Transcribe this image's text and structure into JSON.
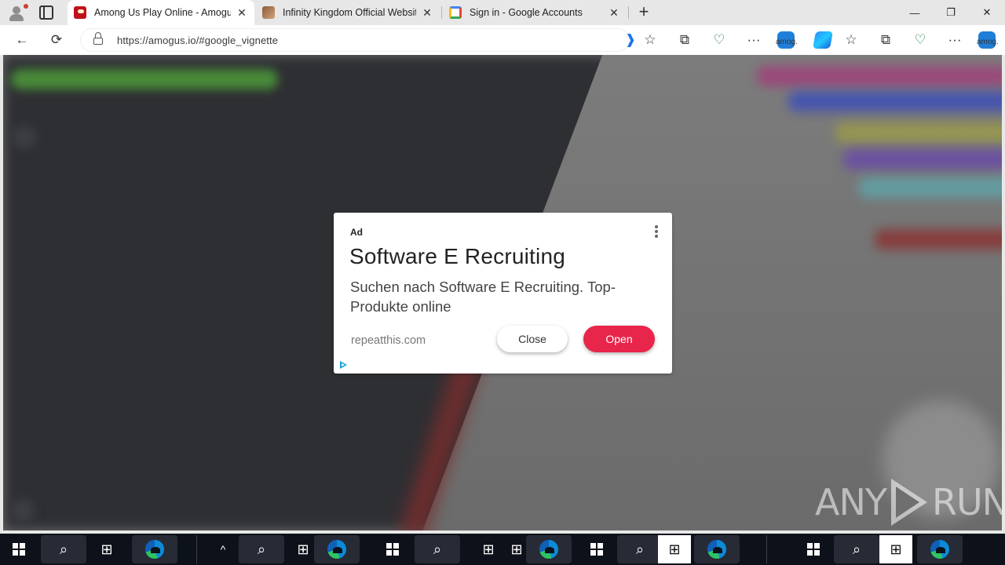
{
  "browser": {
    "tabs": [
      {
        "title": "Among Us Play Online - Amogus",
        "favicon": "amogus-favicon",
        "active": true
      },
      {
        "title": "Infinity Kingdom Official Website",
        "favicon": "infinity-kingdom-favicon",
        "active": false
      },
      {
        "title": "Sign in - Google Accounts",
        "favicon": "google-favicon",
        "active": false
      }
    ],
    "close_glyph": "✕",
    "new_tab_glyph": "+",
    "window_controls": {
      "minimize": "—",
      "restore": "❐",
      "close": "✕"
    },
    "toolbar": {
      "back_glyph": "←",
      "refresh_glyph": "⟳",
      "url": "https://amogus.io/#google_vignette",
      "favorites_glyph": "☆",
      "collections_glyph": "⧉",
      "more_glyph": "···",
      "extension_label": "amog."
    }
  },
  "ad": {
    "tag": "Ad",
    "title": "Software E Recruiting",
    "description": "Suchen nach Software E Recruiting. Top-Produkte online",
    "domain": "repeatthis.com",
    "close_label": "Close",
    "open_label": "Open",
    "accent_color": "#e8254a"
  },
  "watermark": {
    "left": "ANY",
    "right": "RUN"
  },
  "taskbar": {
    "search_glyph": "⌕",
    "taskview_glyph": "⊞",
    "chevron_glyph": "^"
  }
}
